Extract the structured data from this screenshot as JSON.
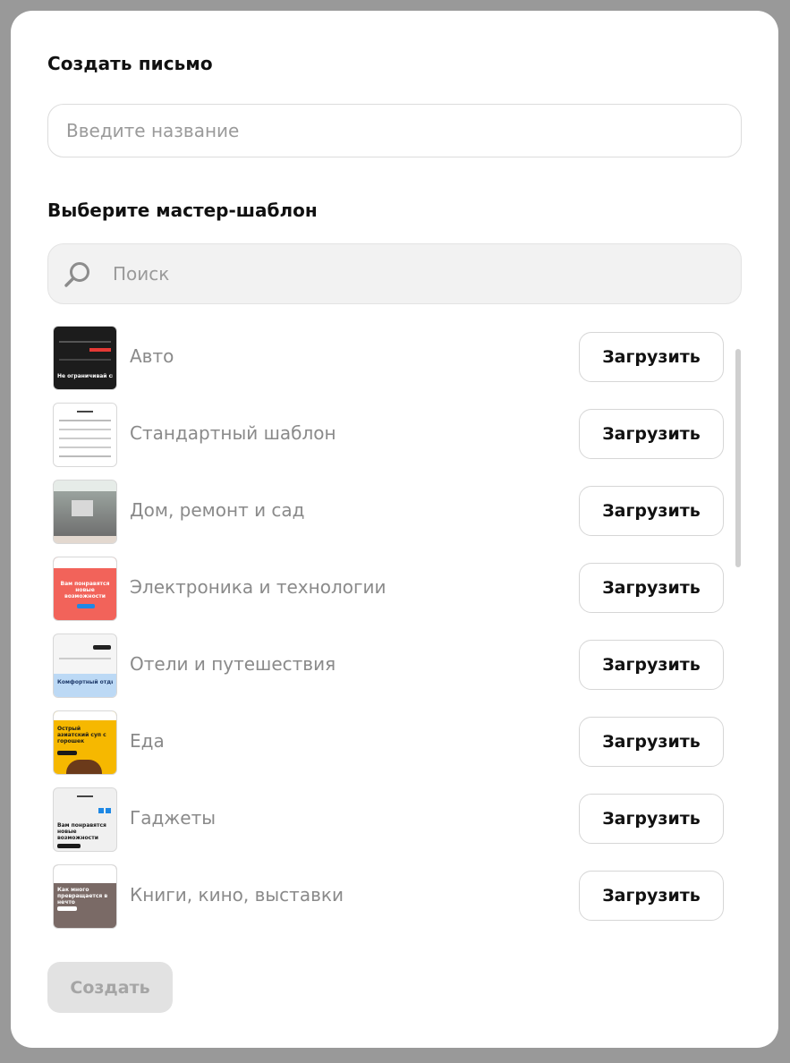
{
  "modal": {
    "title": "Создать письмо",
    "name_input": {
      "value": "",
      "placeholder": "Введите название"
    },
    "template_title": "Выберите мастер-шаблон",
    "search": {
      "value": "",
      "placeholder": "Поиск",
      "icon": "search-icon"
    },
    "templates": [
      {
        "label": "Авто",
        "button": "Загрузить",
        "thumb_bg": "#1c1c1c",
        "thumb_accent": "#e53935",
        "thumb_text": "Не ограничивай свои возможности"
      },
      {
        "label": "Стандартный шаблон",
        "button": "Загрузить",
        "thumb_bg": "#ffffff",
        "thumb_accent": "#333333",
        "thumb_text": ""
      },
      {
        "label": "Дом, ремонт и сад",
        "button": "Загрузить",
        "thumb_bg": "#e6ece8",
        "thumb_accent": "#8b8b8b",
        "thumb_text": ""
      },
      {
        "label": "Электроника и технологии",
        "button": "Загрузить",
        "thumb_bg": "#f2635a",
        "thumb_accent": "#1e88e5",
        "thumb_text": "Вам понравятся новые возможности"
      },
      {
        "label": "Отели и путешествия",
        "button": "Загрузить",
        "thumb_bg": "#f5f5f5",
        "thumb_accent": "#bcd9f5",
        "thumb_text": "Комфортный отдых"
      },
      {
        "label": "Еда",
        "button": "Загрузить",
        "thumb_bg": "#f6b800",
        "thumb_accent": "#1a1a1a",
        "thumb_text": "Острый азиатский суп с горошек"
      },
      {
        "label": "Гаджеты",
        "button": "Загрузить",
        "thumb_bg": "#f0f0f0",
        "thumb_accent": "#1e88e5",
        "thumb_text": "Вам понравятся новые возможности"
      },
      {
        "label": "Книги, кино, выставки",
        "button": "Загрузить",
        "thumb_bg": "#7a6a66",
        "thumb_accent": "#ffffff",
        "thumb_text": "Как много превращается в нечто"
      }
    ],
    "create_button": "Создать",
    "create_disabled": true
  }
}
